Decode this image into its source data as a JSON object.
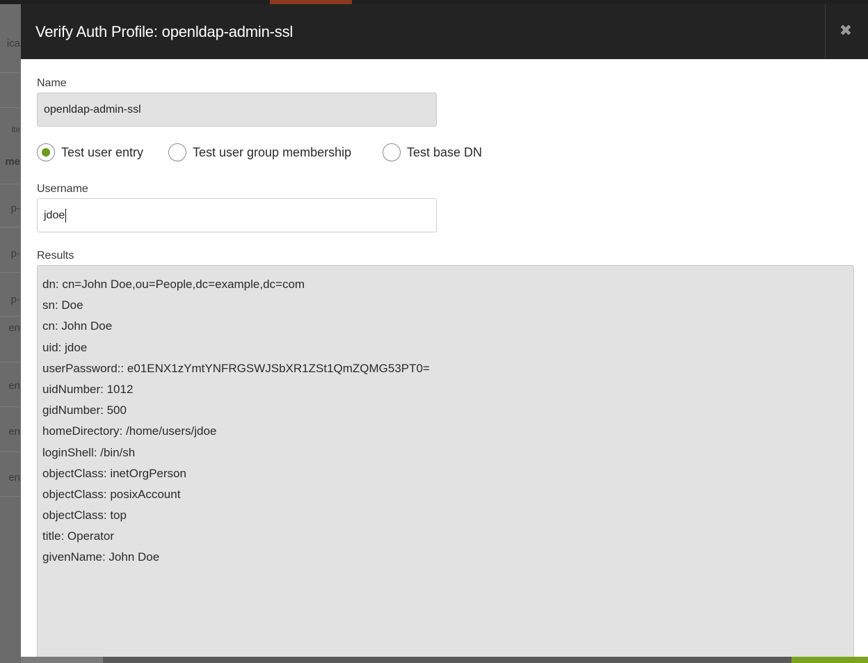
{
  "background": {
    "left_fragments": [
      "ica",
      "ite",
      "me",
      "p-",
      "p-",
      "p-",
      "en",
      "en",
      "en",
      "en"
    ]
  },
  "modal": {
    "title": "Verify Auth Profile: openldap-admin-ssl",
    "close_icon": "close-icon",
    "name_label": "Name",
    "name_value": "openldap-admin-ssl",
    "test_options": [
      {
        "label": "Test user entry",
        "checked": true
      },
      {
        "label": "Test user group membership",
        "checked": false
      },
      {
        "label": "Test base DN",
        "checked": false
      }
    ],
    "username_label": "Username",
    "username_value": "jdoe",
    "results_label": "Results",
    "results": [
      "dn: cn=John Doe,ou=People,dc=example,dc=com",
      "sn: Doe",
      "cn: John Doe",
      "uid: jdoe",
      "userPassword:: e01ENX1zYmtYNFRGSWJSbXR1ZSt1QmZQMG53PT0=",
      "uidNumber: 1012",
      "gidNumber: 500",
      "homeDirectory: /home/users/jdoe",
      "loginShell: /bin/sh",
      "objectClass: inetOrgPerson",
      "objectClass: posixAccount",
      "objectClass: top",
      "title: Operator",
      "givenName: John Doe"
    ]
  },
  "colors": {
    "header_bg": "#232323",
    "radio_accent": "#6c9a1c",
    "readonly_field_bg": "#e2e2e2"
  }
}
